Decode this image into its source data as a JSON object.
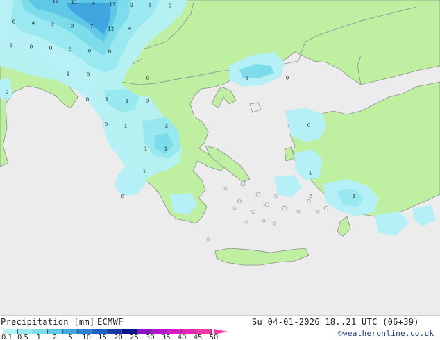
{
  "title": "Precipitation [mm]",
  "model": "ECMWF",
  "datetime": "Su 04-01-2026 18..21 UTC (06+39)",
  "credit": "©weatheronline.co.uk",
  "colors": {
    "sea": "#ececec",
    "land": "#bff0a2",
    "coast": "#8c8c8c",
    "border": "#7f8e96"
  },
  "legend": {
    "ticks": [
      "0.1",
      "0.5",
      "1",
      "2",
      "5",
      "10",
      "15",
      "20",
      "25",
      "30",
      "35",
      "40",
      "45",
      "50"
    ],
    "colors": [
      "#b4f0f5",
      "#98e8f0",
      "#7cdcea",
      "#5ec8e6",
      "#3fa6e0",
      "#2a80d8",
      "#1a5ec8",
      "#1438a8",
      "#0a148c",
      "#8c10c8",
      "#b414d2",
      "#d41cc8",
      "#e426b4",
      "#ee3aa8"
    ]
  },
  "map_values": [
    "12",
    "11",
    "4",
    "13",
    "2",
    "1",
    "0",
    "0",
    "4",
    "2",
    "0",
    "7",
    "12",
    "4",
    "1",
    "0",
    "0",
    "0",
    "0",
    "8",
    "1",
    "0",
    "0",
    "0",
    "1",
    "0",
    "1",
    "0",
    "0",
    "1",
    "2",
    "1",
    "1",
    "1",
    "1",
    "0",
    "0",
    "0",
    "1",
    "1",
    "0"
  ]
}
